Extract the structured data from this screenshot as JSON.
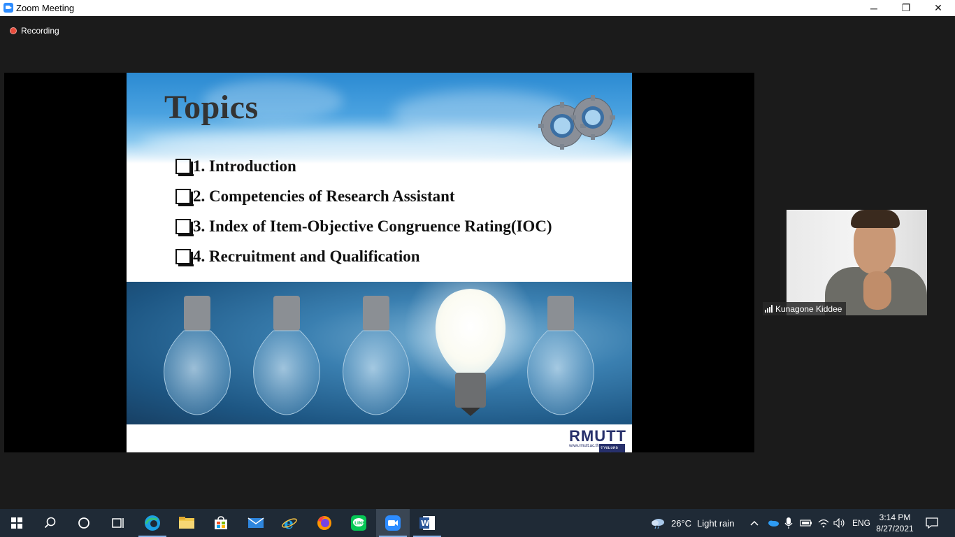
{
  "window": {
    "title": "Zoom Meeting",
    "minimize_glyph": "─",
    "restore_glyph": "❐",
    "close_glyph": "✕"
  },
  "recording": {
    "label": "Recording"
  },
  "slide": {
    "title": "Topics",
    "topics": [
      "1. Introduction",
      "2. Competencies of Research Assistant",
      "3. Index of Item-Objective Congruence Rating(IOC)",
      "4. Recruitment and Qualification"
    ],
    "logo_text": "RMUTT",
    "logo_url": "www.rmutt.ac.th",
    "logo_thai": "ราชมงคลธัญบุรี"
  },
  "participant": {
    "name": "Kunagone Kiddee"
  },
  "taskbar": {
    "icons": [
      "windows-start-icon",
      "search-icon",
      "cortana-icon",
      "task-view-icon",
      "edge-icon",
      "file-explorer-icon",
      "store-icon",
      "mail-icon",
      "internet-explorer-icon",
      "firefox-icon",
      "line-icon",
      "zoom-icon",
      "word-icon"
    ],
    "weather": {
      "temperature": "26°C",
      "condition": "Light rain"
    },
    "language": "ENG",
    "time": "3:14 PM",
    "date": "8/27/2021"
  },
  "colors": {
    "window_bg": "#1b1b1b",
    "taskbar_bg": "#1f2a36",
    "recording_red": "#e74c3c",
    "zoom_blue": "#2d8cff"
  }
}
